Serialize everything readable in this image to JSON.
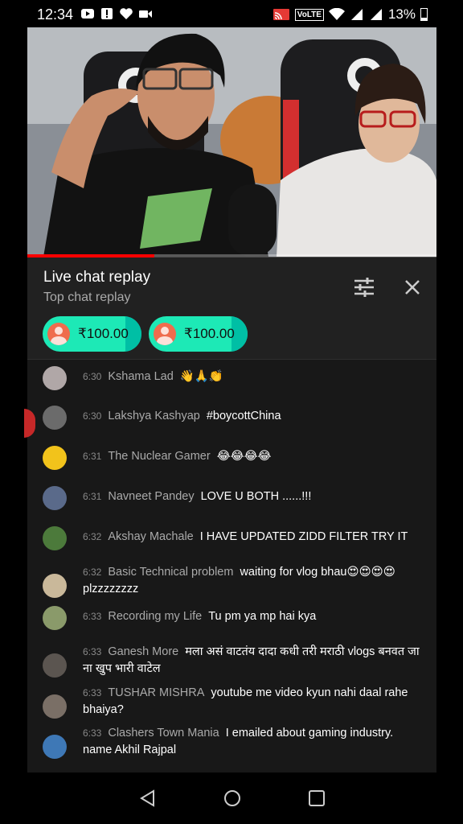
{
  "status_bar": {
    "time": "12:34",
    "volte": "VoLTE",
    "battery": "13%",
    "icons": [
      "youtube-icon",
      "alert-icon",
      "heart-icon",
      "video-camera-icon",
      "cast-icon",
      "wifi-icon",
      "signal-icon",
      "signal-icon",
      "battery-icon"
    ]
  },
  "video": {
    "progress_fraction": 0.31
  },
  "chat": {
    "title": "Live chat replay",
    "subtitle": "Top chat replay",
    "super_chats": [
      {
        "amount": "₹100.00"
      },
      {
        "amount": "₹100.00"
      }
    ],
    "messages": [
      {
        "time": "6:30",
        "author": "Kshama Lad",
        "text": "👋🙏👏",
        "avatar_color": "#b0a7a7"
      },
      {
        "time": "6:30",
        "author": "Lakshya Kashyap",
        "text": "#boycottChina",
        "avatar_color": "#6b6b6b"
      },
      {
        "time": "6:31",
        "author": "The Nuclear Gamer",
        "text": "😂😂😂😂",
        "avatar_color": "#f2c31b"
      },
      {
        "time": "6:31",
        "author": "Navneet Pandey",
        "text": "LOVE U BOTH ......!!!",
        "avatar_color": "#5a6a8a"
      },
      {
        "time": "6:32",
        "author": "Akshay Machale",
        "text": "I HAVE UPDATED ZIDD FILTER TRY IT",
        "avatar_color": "#4c7a3b"
      },
      {
        "time": "6:32",
        "author": "Basic Technical problem",
        "text": "waiting for vlog bhau😍😍😍😍plzzzzzzzz",
        "avatar_color": "#c9b89a"
      },
      {
        "time": "6:33",
        "author": "Recording my Life",
        "text": "Tu pm ya mp hai kya",
        "avatar_color": "#8a9a6a"
      },
      {
        "time": "6:33",
        "author": "Ganesh More",
        "text": "मला असं वाटतंय दादा कधी तरी मराठी vlogs बनवत जा ना खुप भारी वाटेल",
        "avatar_color": "#5b5550"
      },
      {
        "time": "6:33",
        "author": "TUSHAR MISHRA",
        "text": "youtube me video kyun nahi daal rahe bhaiya?",
        "avatar_color": "#7a6f66"
      },
      {
        "time": "6:33",
        "author": "Clashers Town Mania",
        "text": "I emailed about gaming industry. name Akhil Rajpal",
        "avatar_color": "#3e78b6"
      }
    ]
  },
  "colors": {
    "live_red": "#ff0000",
    "super_chat": "#1de9b6",
    "panel_bg": "#181818",
    "header_bg": "#212121"
  }
}
